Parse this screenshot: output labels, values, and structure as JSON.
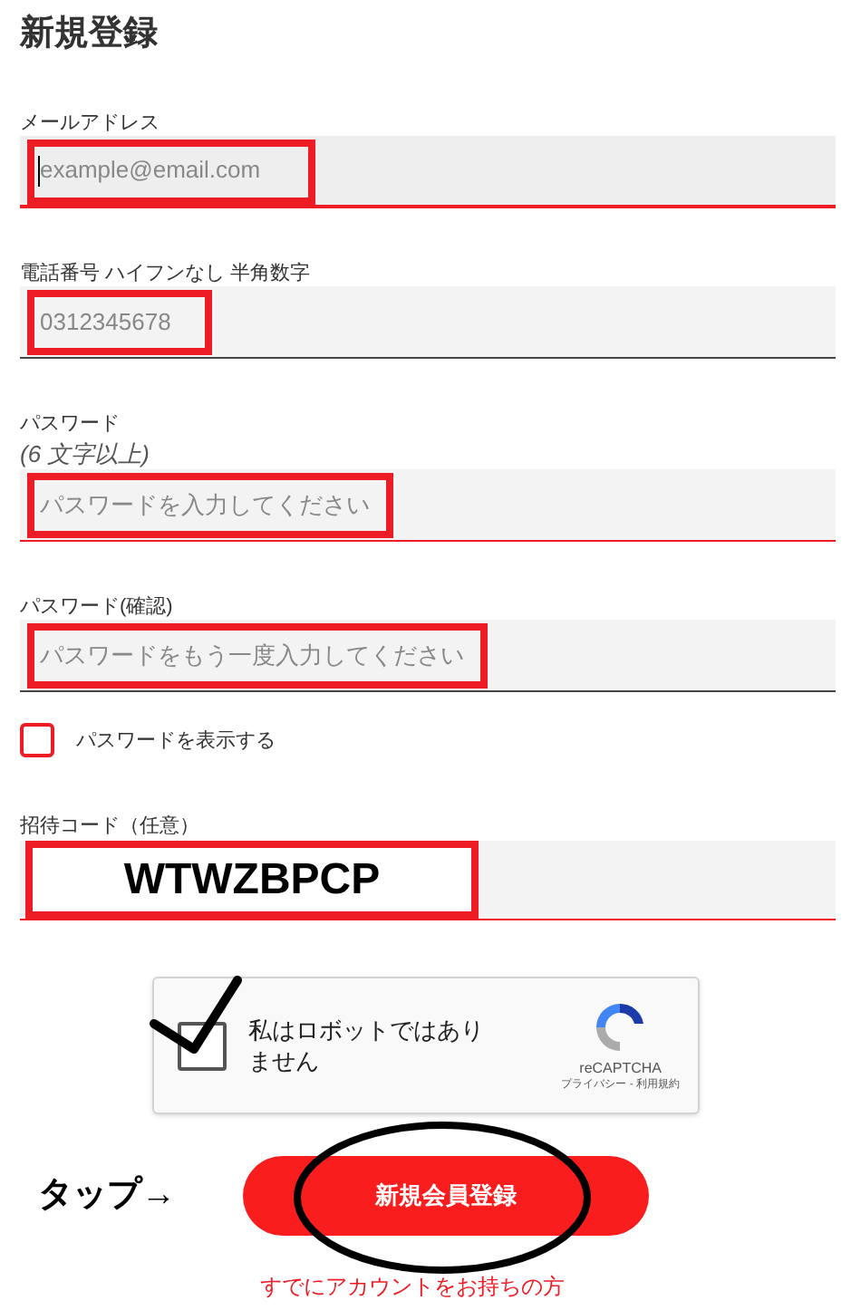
{
  "title": "新規登録",
  "fields": [
    {
      "kind": "text",
      "label": "メールアドレス",
      "placeholder": "example@email.com",
      "error": true,
      "focused": true
    },
    {
      "kind": "text",
      "label": "電話番号 ハイフンなし 半角数字",
      "placeholder": "0312345678",
      "error": false,
      "focused": false
    },
    {
      "kind": "text",
      "label": "パスワード",
      "hint": "(6 文字以上)",
      "placeholder": "パスワードを入力してください",
      "error": true,
      "focused": false
    },
    {
      "kind": "text",
      "label": "パスワード(確認)",
      "placeholder": "パスワードをもう一度入力してください",
      "error": false,
      "focused": false
    },
    {
      "kind": "checkbox",
      "label": "パスワードを表示する",
      "checked": false
    },
    {
      "kind": "code",
      "label": "招待コード（任意）",
      "value": "WTWZBPCP",
      "error": true,
      "focused": false
    }
  ],
  "captcha": {
    "label": "私はロボットではありません",
    "checked": true,
    "brand": "reCAPTCHA",
    "links": "プライバシー - 利用規約"
  },
  "tap_note": "タップ→",
  "submit": "新規会員登録",
  "login_link": "すでにアカウントをお持ちの方"
}
